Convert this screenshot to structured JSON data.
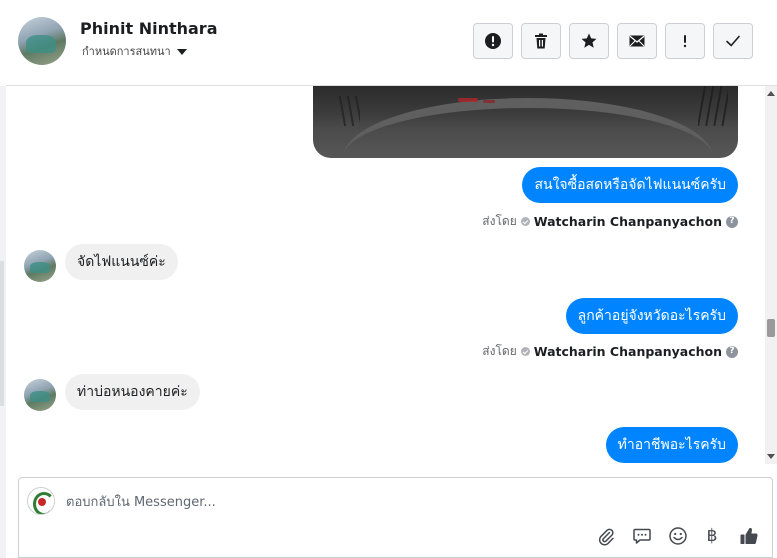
{
  "header": {
    "contact_name": "Phinit Ninthara",
    "assign_label": "กำหนดการสนทนา"
  },
  "toolbar": {
    "buttons": [
      {
        "name": "spam",
        "icon": "alert-circle-icon"
      },
      {
        "name": "delete",
        "icon": "trash-icon"
      },
      {
        "name": "star",
        "icon": "star-icon"
      },
      {
        "name": "mark-unread",
        "icon": "envelope-icon"
      },
      {
        "name": "follow-up",
        "icon": "exclamation-icon"
      },
      {
        "name": "done",
        "icon": "checkmark-icon"
      }
    ]
  },
  "messages": [
    {
      "direction": "out",
      "type": "image"
    },
    {
      "direction": "out",
      "text": "สนใจซื้อสดหรือจัดไฟแนนซ์ครับ",
      "sent_by_label": "ส่งโดย",
      "agent": "Watcharin Chanpanyachon"
    },
    {
      "direction": "in",
      "text": "จัดไฟแนนซ์ค่ะ"
    },
    {
      "direction": "out",
      "text": "ลูกค้าอยู่จังหวัดอะไรครับ",
      "sent_by_label": "ส่งโดย",
      "agent": "Watcharin Chanpanyachon"
    },
    {
      "direction": "in",
      "text": "ท่าบ่อหนองคายค่ะ"
    },
    {
      "direction": "out",
      "text": "ทำอาชีพอะไรครับ"
    }
  ],
  "composer": {
    "placeholder": "ตอบกลับใน Messenger...",
    "value": "",
    "baht_symbol": "฿",
    "icons": [
      "paperclip-icon",
      "speech-bubble-icon",
      "emoji-icon",
      "baht-icon",
      "thumbs-up-icon"
    ]
  },
  "colors": {
    "accent": "#0084ff",
    "incoming_bubble": "#f0f0f0",
    "border": "#ccd0d5"
  }
}
